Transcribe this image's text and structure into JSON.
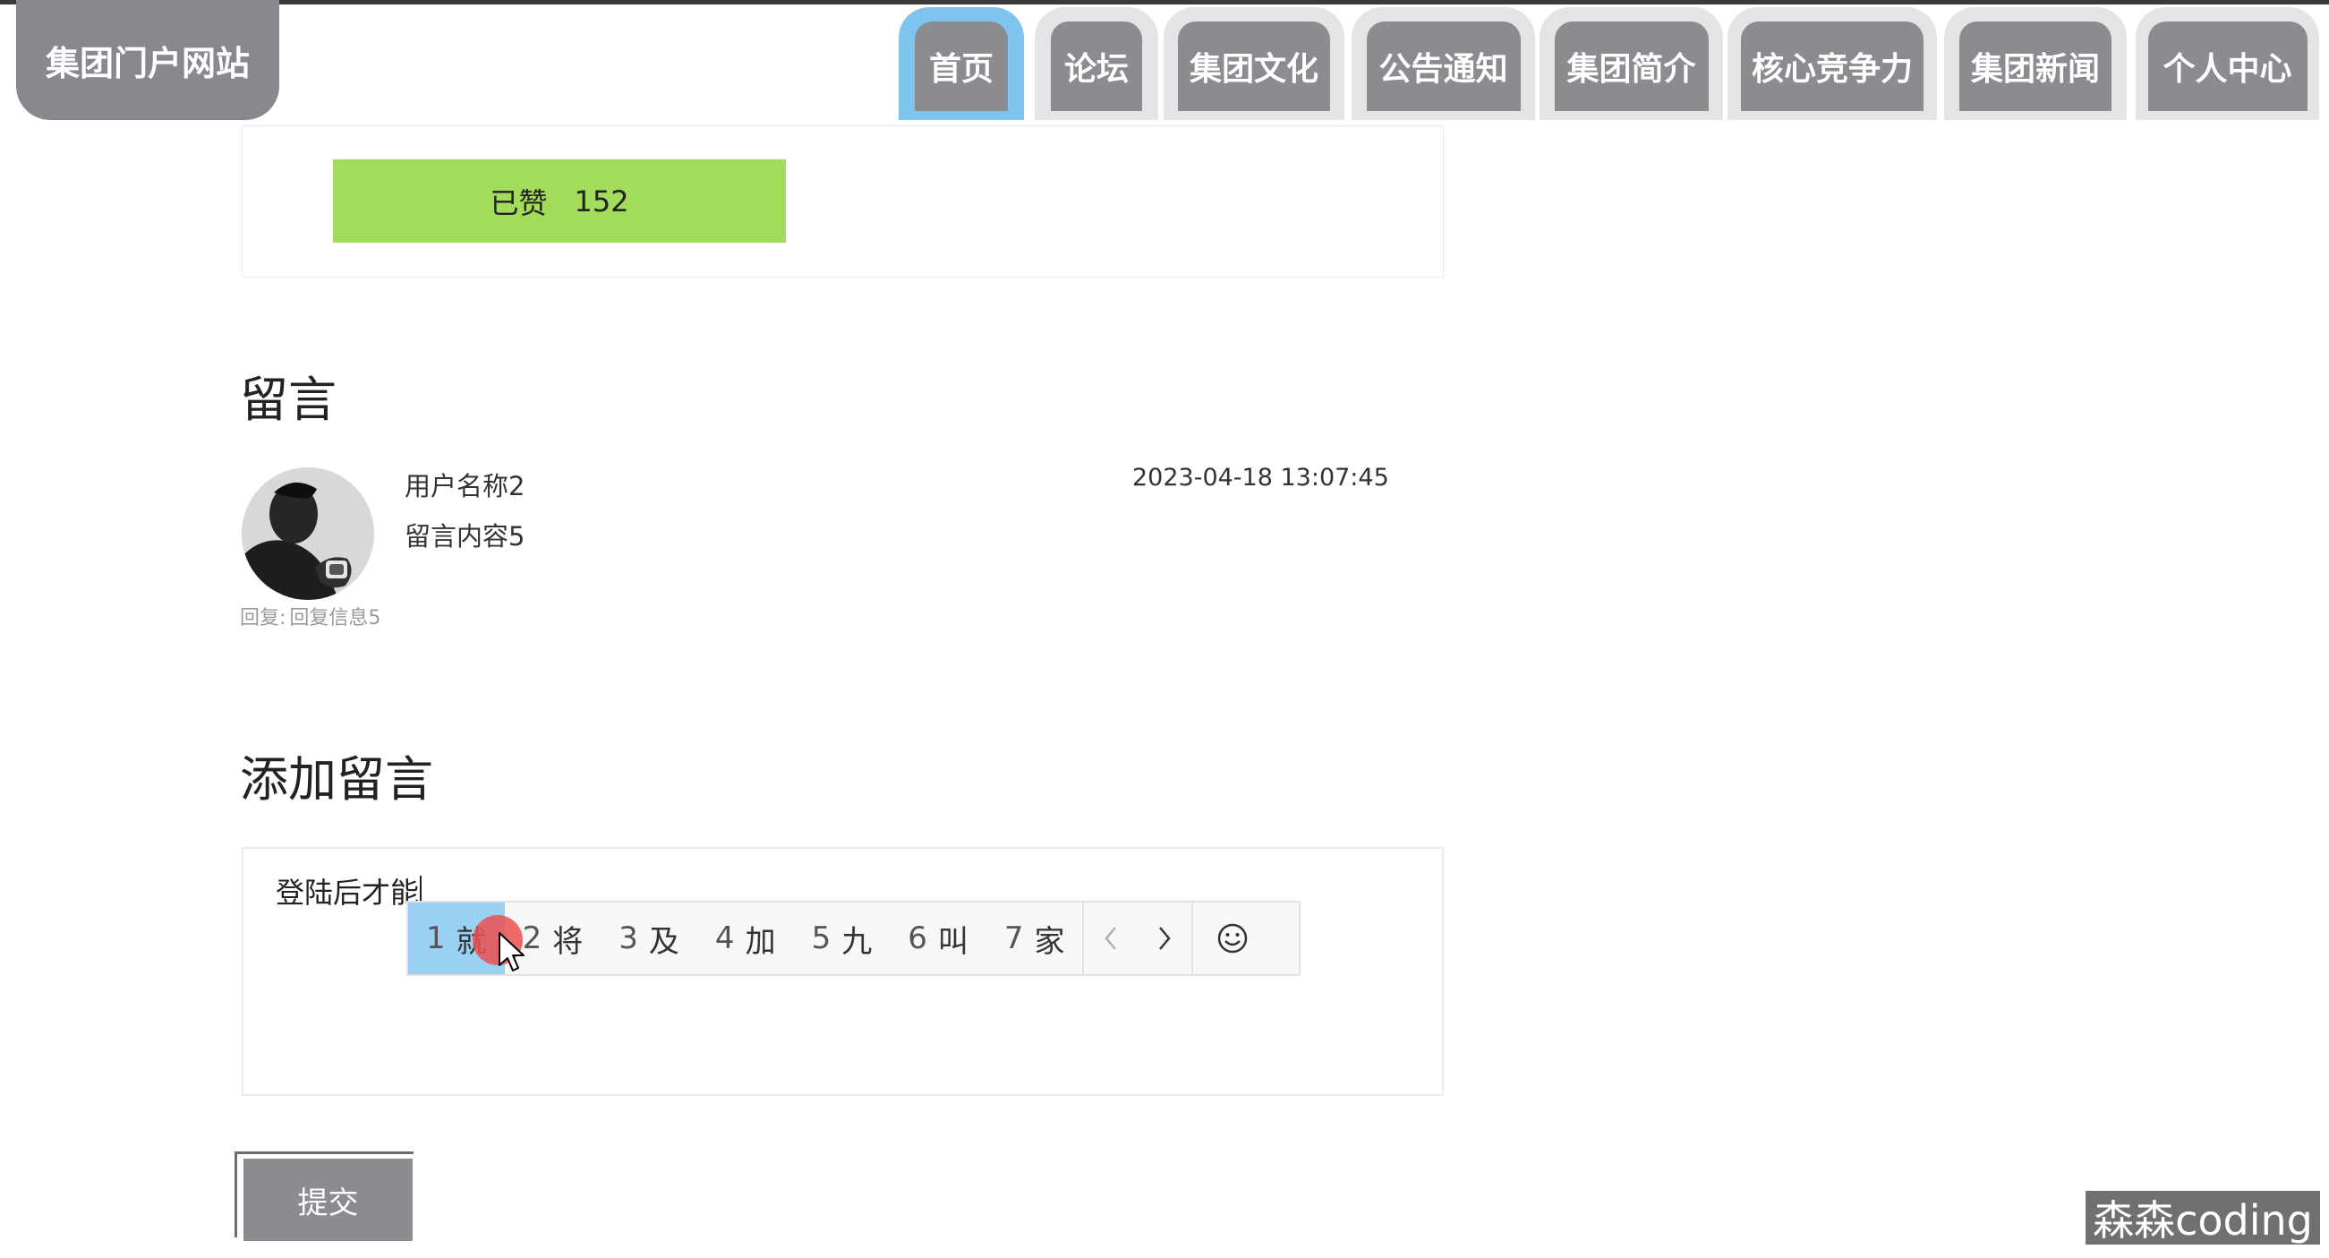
{
  "header": {
    "logo_text": "集团门户网站",
    "nav": [
      {
        "label": "首页",
        "active": true
      },
      {
        "label": "论坛",
        "active": false
      },
      {
        "label": "集团文化",
        "active": false
      },
      {
        "label": "公告通知",
        "active": false
      },
      {
        "label": "集团简介",
        "active": false
      },
      {
        "label": "核心竞争力",
        "active": false
      },
      {
        "label": "集团新闻",
        "active": false
      },
      {
        "label": "个人中心",
        "active": false
      }
    ]
  },
  "like": {
    "label": "已赞",
    "count": "152",
    "color": "#a3dc5a"
  },
  "comments_section": {
    "heading": "留言",
    "items": [
      {
        "user": "用户名称2",
        "content": "留言内容5",
        "time": "2023-04-18 13:07:45",
        "reply_label": "回复:",
        "reply_text": "回复信息5"
      }
    ]
  },
  "add_comment": {
    "heading": "添加留言",
    "input_text": "登陆后才能",
    "submit_label": "提交"
  },
  "ime": {
    "candidates": [
      {
        "num": "1",
        "char": "就",
        "selected": true
      },
      {
        "num": "2",
        "char": "将",
        "selected": false
      },
      {
        "num": "3",
        "char": "及",
        "selected": false
      },
      {
        "num": "4",
        "char": "加",
        "selected": false
      },
      {
        "num": "5",
        "char": "九",
        "selected": false
      },
      {
        "num": "6",
        "char": "叫",
        "selected": false
      },
      {
        "num": "7",
        "char": "家",
        "selected": false
      }
    ],
    "prev_icon": "chevron-left-icon",
    "next_icon": "chevron-right-icon",
    "emoji_icon": "smiley-icon"
  },
  "watermark": "森森coding",
  "colors": {
    "nav_active": "#7fc4ef",
    "nav_button": "#8a8c90",
    "logo_bg": "#87898e"
  }
}
